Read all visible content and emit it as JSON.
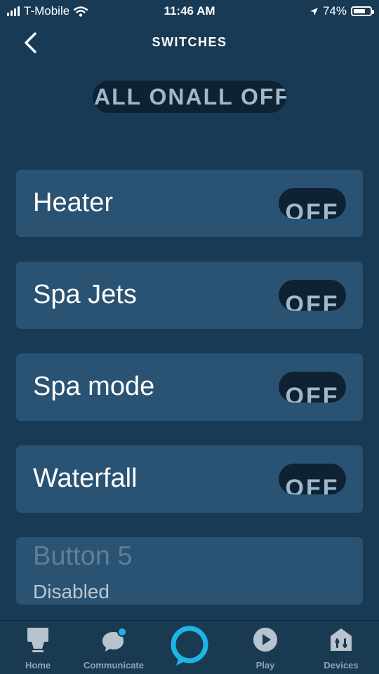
{
  "status_bar": {
    "carrier": "T-Mobile",
    "time": "11:46 AM",
    "battery": "74%",
    "battery_level": 0.74
  },
  "header": {
    "title": "SWITCHES",
    "back_icon": "chevron-left-icon"
  },
  "all_toggle": {
    "on_label": "ALL ON",
    "off_label": "ALL OFF"
  },
  "switches": [
    {
      "label": "Heater",
      "state": "OFF"
    },
    {
      "label": "Spa Jets",
      "state": "OFF"
    },
    {
      "label": "Spa mode",
      "state": "OFF"
    },
    {
      "label": "Waterfall",
      "state": "OFF"
    },
    {
      "label": "Button 5",
      "note": "Disabled"
    }
  ],
  "nav": {
    "items": [
      {
        "label": "Home",
        "icon": "home-icon"
      },
      {
        "label": "Communicate",
        "icon": "chat-bubble-icon"
      },
      {
        "label": "",
        "icon": "alexa-ring-icon"
      },
      {
        "label": "Play",
        "icon": "play-icon"
      },
      {
        "label": "Devices",
        "icon": "devices-icon"
      }
    ]
  },
  "colors": {
    "background": "#183a55",
    "card": "#2a5373",
    "toggle": "#0f2233",
    "toggle_text": "#9fb8cc",
    "accent": "#1fb4e8",
    "nav_label": "#8fa3b4"
  }
}
